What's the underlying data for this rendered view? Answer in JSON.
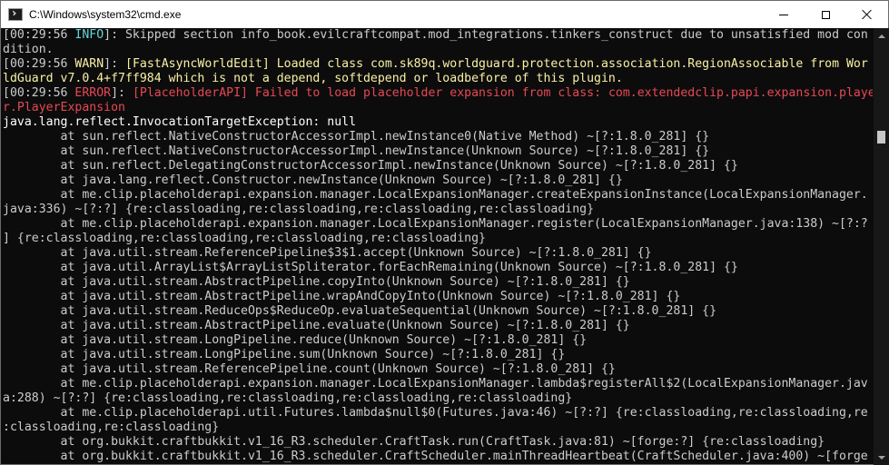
{
  "window": {
    "title": "C:\\Windows\\system32\\cmd.exe"
  },
  "colors": {
    "info": "#61d6d6",
    "warn": "#f9f1a5",
    "error": "#e74856",
    "text": "#cccccc",
    "background": "#0c0c0c"
  },
  "console": {
    "lines": [
      [
        {
          "t": "[00:29:56 ",
          "c": "gray"
        },
        {
          "t": "INFO",
          "c": "info"
        },
        {
          "t": "]: Skipped section info_book.evilcraftcompat.mod_integrations.tinkers_construct due to unsatisfied mod con",
          "c": "gray"
        }
      ],
      [
        {
          "t": "dition.",
          "c": "gray"
        }
      ],
      [
        {
          "t": "[00:29:56 ",
          "c": "gray"
        },
        {
          "t": "WARN",
          "c": "warn"
        },
        {
          "t": "]: ",
          "c": "gray"
        },
        {
          "t": "[FastAsyncWorldEdit] Loaded class com.sk89q.worldguard.protection.association.RegionAssociable from Wor",
          "c": "warn"
        }
      ],
      [
        {
          "t": "ldGuard v7.0.4+f7ff984 which is not a depend, softdepend or loadbefore of this plugin.",
          "c": "warn"
        }
      ],
      [
        {
          "t": "[00:29:56 ",
          "c": "gray"
        },
        {
          "t": "ERROR",
          "c": "error"
        },
        {
          "t": "]: ",
          "c": "gray"
        },
        {
          "t": "[PlaceholderAPI] Failed to load placeholder expansion from class: com.extendedclip.papi.expansion.playe",
          "c": "error"
        }
      ],
      [
        {
          "t": "r.PlayerExpansion",
          "c": "error"
        }
      ],
      [
        {
          "t": "java.lang.reflect.InvocationTargetException: null",
          "c": "white"
        }
      ],
      [
        {
          "t": "        at sun.reflect.NativeConstructorAccessorImpl.newInstance0(Native Method) ~[?:1.8.0_281] {}",
          "c": "gray"
        }
      ],
      [
        {
          "t": "        at sun.reflect.NativeConstructorAccessorImpl.newInstance(Unknown Source) ~[?:1.8.0_281] {}",
          "c": "gray"
        }
      ],
      [
        {
          "t": "        at sun.reflect.DelegatingConstructorAccessorImpl.newInstance(Unknown Source) ~[?:1.8.0_281] {}",
          "c": "gray"
        }
      ],
      [
        {
          "t": "        at java.lang.reflect.Constructor.newInstance(Unknown Source) ~[?:1.8.0_281] {}",
          "c": "gray"
        }
      ],
      [
        {
          "t": "        at me.clip.placeholderapi.expansion.manager.LocalExpansionManager.createExpansionInstance(LocalExpansionManager.",
          "c": "gray"
        }
      ],
      [
        {
          "t": "java:336) ~[?:?] {re:classloading,re:classloading,re:classloading,re:classloading}",
          "c": "gray"
        }
      ],
      [
        {
          "t": "        at me.clip.placeholderapi.expansion.manager.LocalExpansionManager.register(LocalExpansionManager.java:138) ~[?:?",
          "c": "gray"
        }
      ],
      [
        {
          "t": "] {re:classloading,re:classloading,re:classloading,re:classloading}",
          "c": "gray"
        }
      ],
      [
        {
          "t": "        at java.util.stream.ReferencePipeline$3$1.accept(Unknown Source) ~[?:1.8.0_281] {}",
          "c": "gray"
        }
      ],
      [
        {
          "t": "        at java.util.ArrayList$ArrayListSpliterator.forEachRemaining(Unknown Source) ~[?:1.8.0_281] {}",
          "c": "gray"
        }
      ],
      [
        {
          "t": "        at java.util.stream.AbstractPipeline.copyInto(Unknown Source) ~[?:1.8.0_281] {}",
          "c": "gray"
        }
      ],
      [
        {
          "t": "        at java.util.stream.AbstractPipeline.wrapAndCopyInto(Unknown Source) ~[?:1.8.0_281] {}",
          "c": "gray"
        }
      ],
      [
        {
          "t": "        at java.util.stream.ReduceOps$ReduceOp.evaluateSequential(Unknown Source) ~[?:1.8.0_281] {}",
          "c": "gray"
        }
      ],
      [
        {
          "t": "        at java.util.stream.AbstractPipeline.evaluate(Unknown Source) ~[?:1.8.0_281] {}",
          "c": "gray"
        }
      ],
      [
        {
          "t": "        at java.util.stream.LongPipeline.reduce(Unknown Source) ~[?:1.8.0_281] {}",
          "c": "gray"
        }
      ],
      [
        {
          "t": "        at java.util.stream.LongPipeline.sum(Unknown Source) ~[?:1.8.0_281] {}",
          "c": "gray"
        }
      ],
      [
        {
          "t": "        at java.util.stream.ReferencePipeline.count(Unknown Source) ~[?:1.8.0_281] {}",
          "c": "gray"
        }
      ],
      [
        {
          "t": "        at me.clip.placeholderapi.expansion.manager.LocalExpansionManager.lambda$registerAll$2(LocalExpansionManager.jav",
          "c": "gray"
        }
      ],
      [
        {
          "t": "a:288) ~[?:?] {re:classloading,re:classloading,re:classloading,re:classloading}",
          "c": "gray"
        }
      ],
      [
        {
          "t": "        at me.clip.placeholderapi.util.Futures.lambda$null$0(Futures.java:46) ~[?:?] {re:classloading,re:classloading,re",
          "c": "gray"
        }
      ],
      [
        {
          "t": ":classloading,re:classloading}",
          "c": "gray"
        }
      ],
      [
        {
          "t": "        at org.bukkit.craftbukkit.v1_16_R3.scheduler.CraftTask.run(CraftTask.java:81) ~[forge:?] {re:classloading}",
          "c": "gray"
        }
      ],
      [
        {
          "t": "        at org.bukkit.craftbukkit.v1_16_R3.scheduler.CraftScheduler.mainThreadHeartbeat(CraftScheduler.java:400) ~[forge",
          "c": "gray"
        }
      ]
    ]
  }
}
